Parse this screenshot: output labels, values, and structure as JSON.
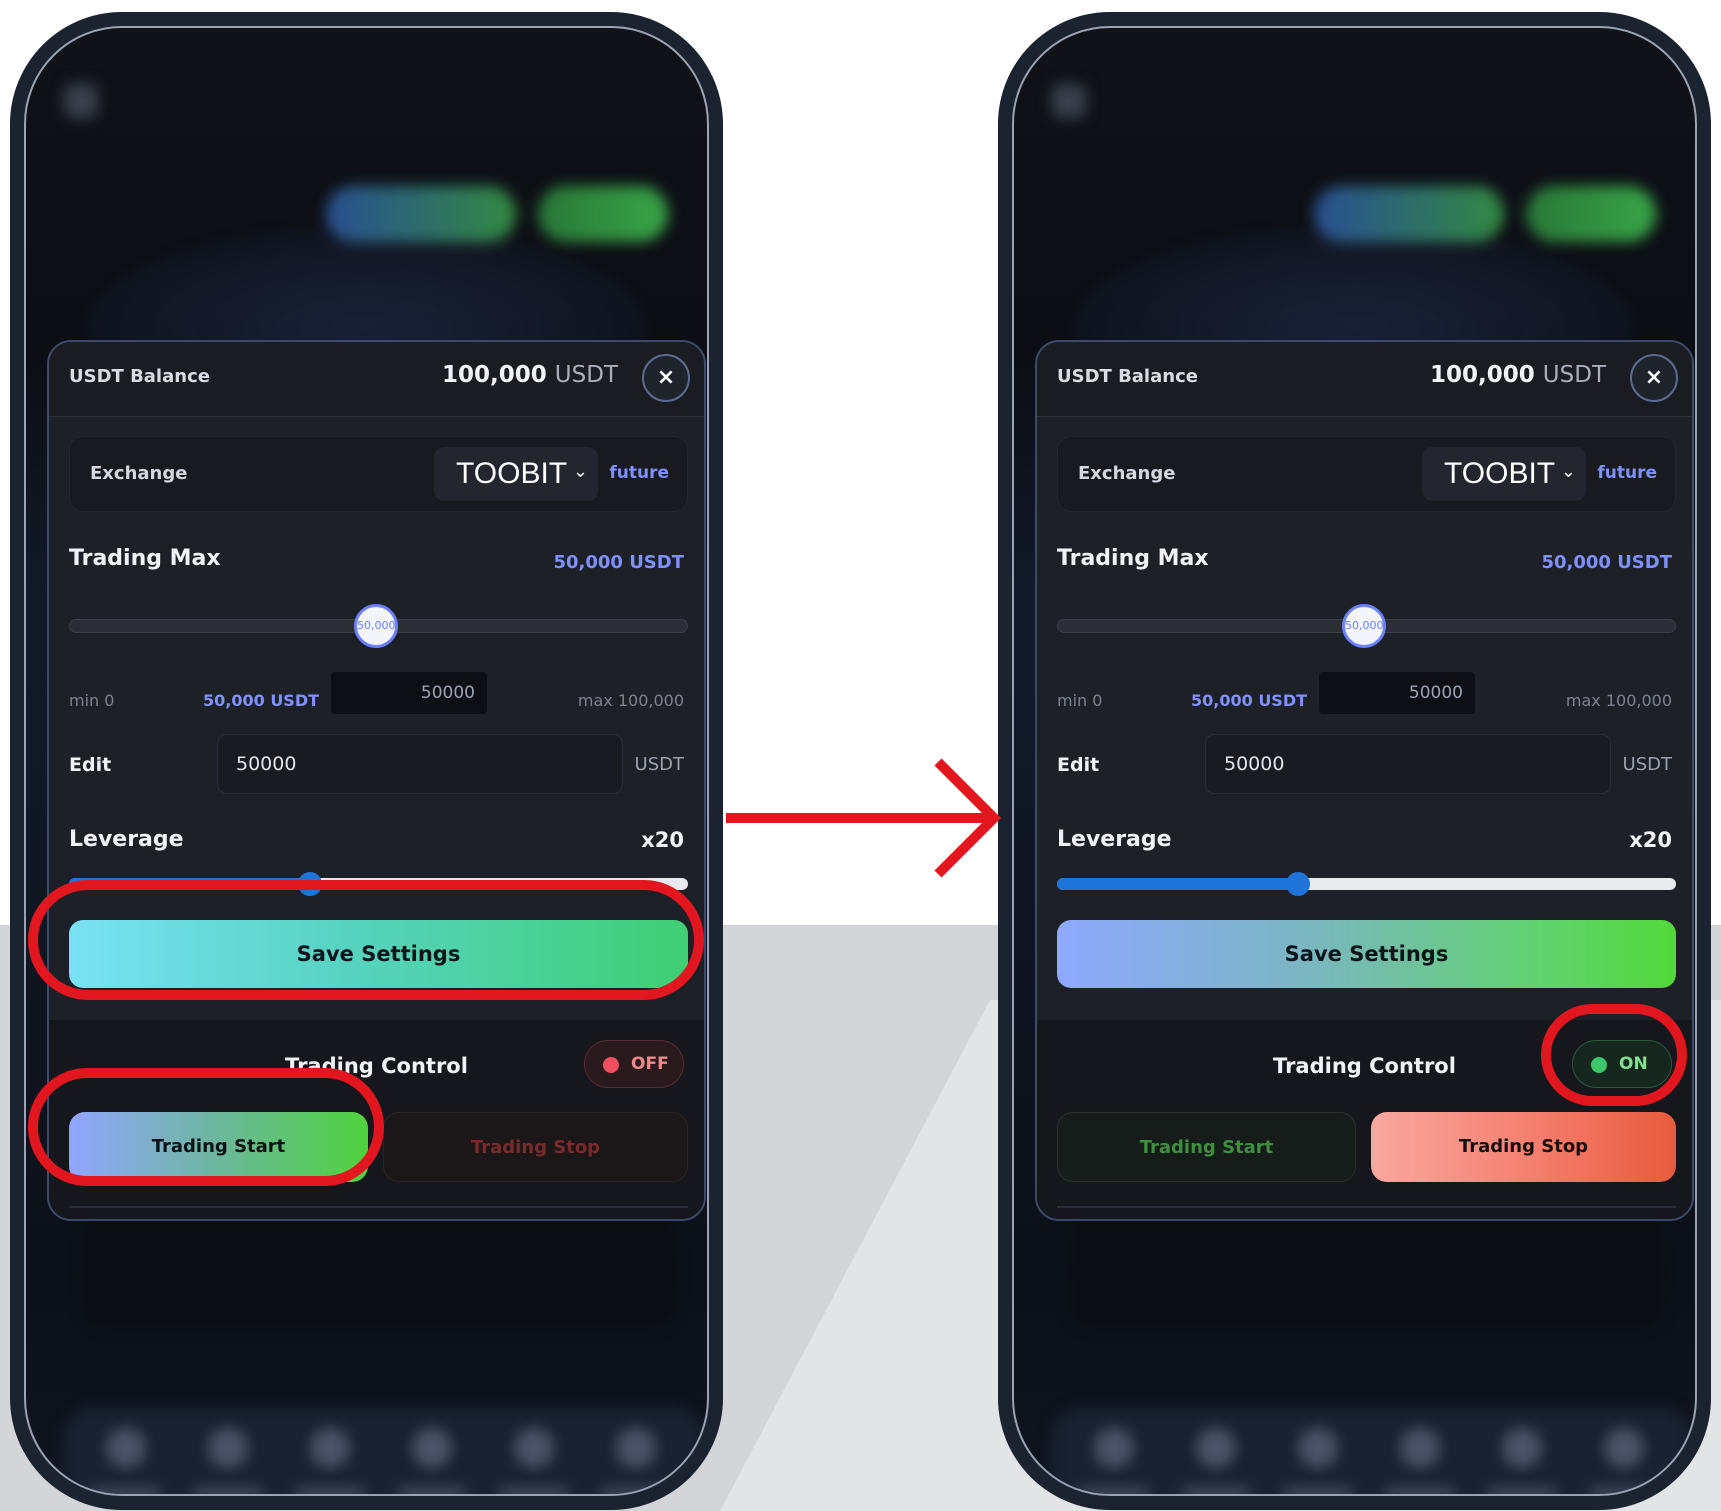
{
  "colors": {
    "highlight": "#e2161e",
    "accent_blue": "#7f90ff",
    "leverage_blue": "#1e74d8",
    "status_off": "#ef4f5f",
    "status_on": "#3cc86a"
  },
  "arrow_icon": "right-arrow-icon",
  "screens": {
    "left": {
      "balance_label": "USDT Balance",
      "balance_amount": "100,000",
      "balance_unit": "USDT",
      "close_icon": "×",
      "exchange_label": "Exchange",
      "exchange_value": "TOOBIT",
      "exchange_chevron": "⌄",
      "exchange_type": "future",
      "trading_max_label": "Trading Max",
      "trading_max_value": "50,000 USDT",
      "trading_max_fraction": 0.5,
      "slider_thumb_text": "50,000",
      "min_label": "min 0",
      "current_label": "50,000 USDT",
      "mini_input_value": "50000",
      "max_label": "max 100,000",
      "edit_label": "Edit",
      "edit_value": "50000",
      "edit_unit": "USDT",
      "leverage_label": "Leverage",
      "leverage_value": "x20",
      "leverage_fraction": 0.39,
      "save_label": "Save Settings",
      "control_title": "Trading Control",
      "status_text": "OFF",
      "start_label": "Trading Start",
      "stop_label": "Trading Stop"
    },
    "right": {
      "balance_label": "USDT Balance",
      "balance_amount": "100,000",
      "balance_unit": "USDT",
      "close_icon": "×",
      "exchange_label": "Exchange",
      "exchange_value": "TOOBIT",
      "exchange_chevron": "⌄",
      "exchange_type": "future",
      "trading_max_label": "Trading Max",
      "trading_max_value": "50,000 USDT",
      "trading_max_fraction": 0.5,
      "slider_thumb_text": "50,000",
      "min_label": "min 0",
      "current_label": "50,000 USDT",
      "mini_input_value": "50000",
      "max_label": "max 100,000",
      "edit_label": "Edit",
      "edit_value": "50000",
      "edit_unit": "USDT",
      "leverage_label": "Leverage",
      "leverage_value": "x20",
      "leverage_fraction": 0.39,
      "save_label": "Save Settings",
      "control_title": "Trading Control",
      "status_text": "ON",
      "start_label": "Trading Start",
      "stop_label": "Trading Stop"
    }
  }
}
